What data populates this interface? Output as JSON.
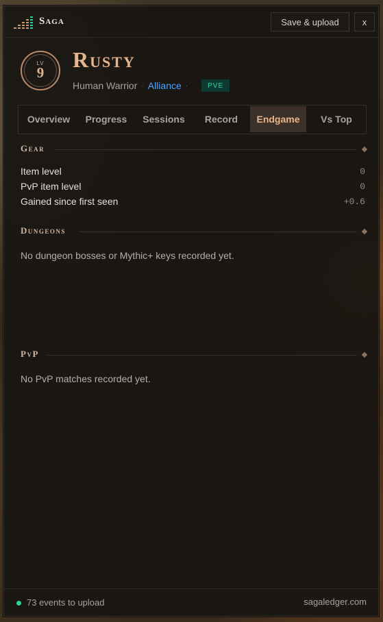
{
  "app": {
    "name": "Saga",
    "logo_icon": "bar-chart-logo-icon"
  },
  "titlebar": {
    "save_label": "Save & upload",
    "close_label": "x"
  },
  "character": {
    "level_label": "LV",
    "level": "9",
    "name": "Rusty",
    "race_class": "Human Warrior",
    "separator": "·",
    "faction": "Alliance",
    "mode_badge": "PVE"
  },
  "tabs": [
    {
      "label": "Overview"
    },
    {
      "label": "Progress"
    },
    {
      "label": "Sessions"
    },
    {
      "label": "Record"
    },
    {
      "label": "Endgame"
    },
    {
      "label": "Vs Top"
    }
  ],
  "active_tab": "Endgame",
  "gear": {
    "title": "Gear",
    "rows": [
      {
        "label": "Item level",
        "value": "0"
      },
      {
        "label": "PvP item level",
        "value": "0"
      },
      {
        "label": "Gained since first seen",
        "value": "+0.6"
      }
    ]
  },
  "dungeons": {
    "title": "Dungeons",
    "empty_text": "No dungeon bosses or Mythic+ keys recorded yet."
  },
  "pvp": {
    "title": "PvP",
    "empty_text": "No PvP matches recorded yet."
  },
  "footer": {
    "status_text": "73 events to upload",
    "site_link": "sagaledger.com"
  },
  "colors": {
    "accent": "#e7b58d",
    "faction_alliance": "#4aa3ff",
    "status_ok": "#2bd29b",
    "active_tab_bg": "#3b3128"
  }
}
